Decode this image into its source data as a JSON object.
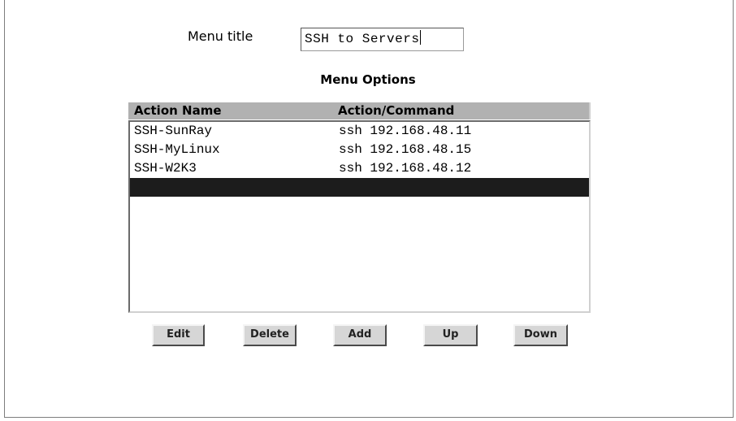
{
  "menu_title": {
    "label": "Menu title",
    "value": "SSH to Servers"
  },
  "options_heading": "Menu Options",
  "table": {
    "columns": [
      "Action Name",
      "Action/Command"
    ],
    "rows": [
      {
        "name": "SSH-SunRay",
        "command": "ssh 192.168.48.11"
      },
      {
        "name": "SSH-MyLinux",
        "command": "ssh 192.168.48.15"
      },
      {
        "name": "SSH-W2K3",
        "command": "ssh 192.168.48.12"
      },
      {
        "name": "",
        "command": ""
      }
    ],
    "selected_row_index": 3
  },
  "buttons": {
    "edit": "Edit",
    "delete": "Delete",
    "add": "Add",
    "up": "Up",
    "down": "Down"
  },
  "colors": {
    "header_bg": "#b1b1b1",
    "selected_row_bg": "#1c1c1c",
    "button_bg": "#d6d6d6"
  }
}
